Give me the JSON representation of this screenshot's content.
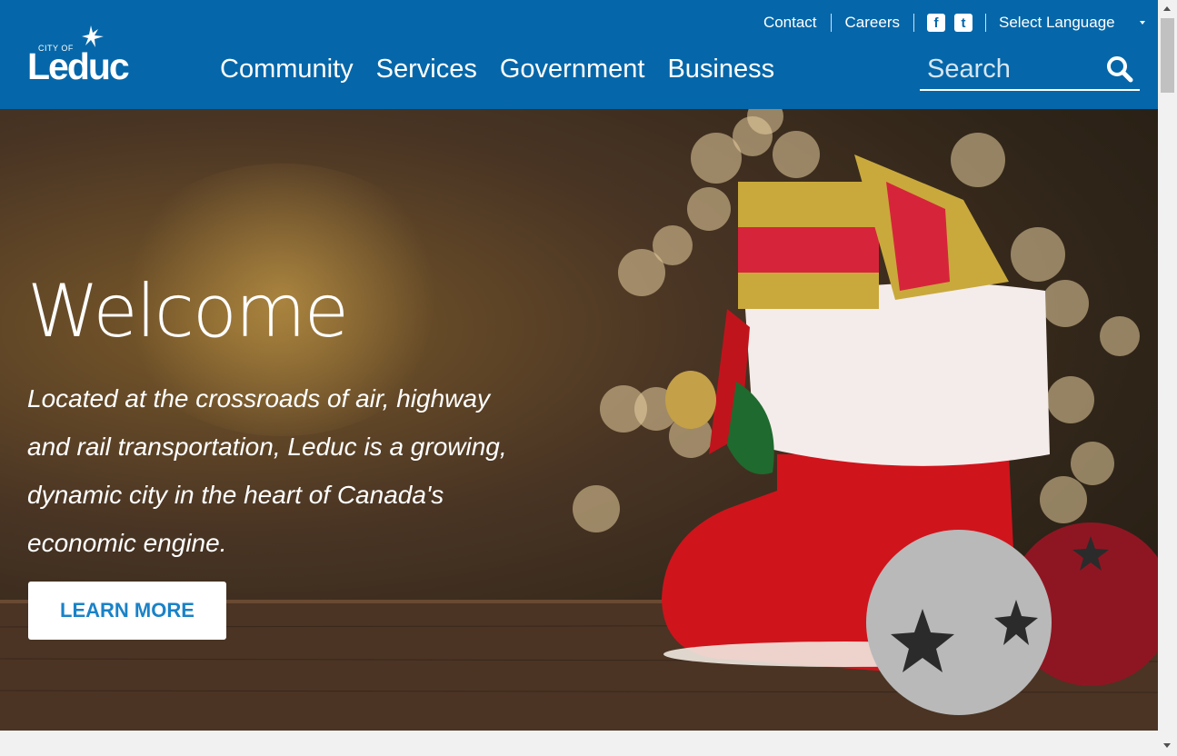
{
  "logo": {
    "city": "CITY OF",
    "name": "Leduc"
  },
  "utility_nav": {
    "contact": "Contact",
    "careers": "Careers",
    "facebook": "f",
    "twitter": "t",
    "language": "Select Language"
  },
  "main_nav": [
    "Community",
    "Services",
    "Government",
    "Business"
  ],
  "search": {
    "placeholder": "Search"
  },
  "hero": {
    "title": "Welcome",
    "tagline": "Located at the crossroads of air, highway and rail transportation, Leduc is a growing, dynamic city in the heart of Canada's economic engine.",
    "button": "LEARN MORE"
  },
  "colors": {
    "header": "#0567a9",
    "button_text": "#1a82c7"
  }
}
